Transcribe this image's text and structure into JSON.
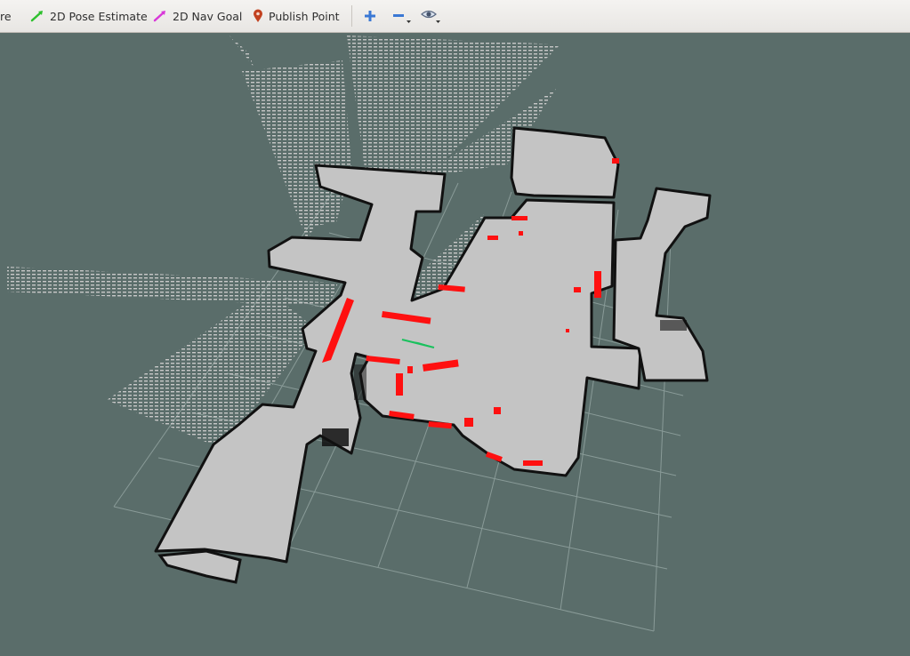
{
  "toolbar": {
    "truncated_tool_label": "re",
    "pose_estimate_label": "2D Pose Estimate",
    "nav_goal_label": "2D Nav Goal",
    "publish_point_label": "Publish Point",
    "icons": {
      "pose_estimate": "green-arrow-icon",
      "nav_goal": "magenta-arrow-icon",
      "publish_point": "map-pin-icon",
      "zoom_in": "plus-icon",
      "zoom_out": "minus-icon",
      "camera_view": "eye-icon"
    }
  },
  "viewport": {
    "colors": {
      "background": "#5a6d6a",
      "free_space": "#c4c4c4",
      "occupied": "#111111",
      "laser_hits": "#ff0000",
      "grid": "#8c9c99",
      "pose_arrow": "#19c15d"
    }
  }
}
